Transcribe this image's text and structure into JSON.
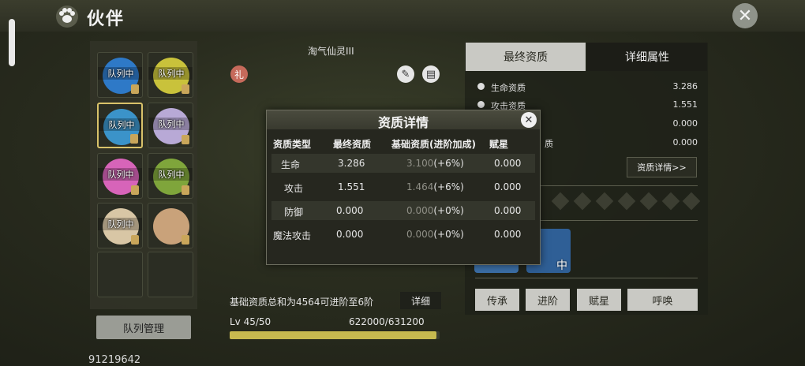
{
  "header": {
    "title": "伙伴",
    "paw_icon": "paw-icon",
    "close_icon": "close-icon"
  },
  "left_panel": {
    "slots": [
      {
        "tag": "队列中",
        "color": "#2e79c7"
      },
      {
        "tag": "队列中",
        "color": "#c9c23b"
      },
      {
        "tag": "队列中",
        "color": "#3b93c9",
        "selected": true
      },
      {
        "tag": "队列中",
        "color": "#b8a9d6"
      },
      {
        "tag": "队列中",
        "color": "#d764b9"
      },
      {
        "tag": "队列中",
        "color": "#7fa53b"
      },
      {
        "tag": "队列中",
        "color": "#d8c6a5"
      },
      {
        "tag": "",
        "color": "#c9a27a"
      },
      {
        "tag": "",
        "color": ""
      },
      {
        "tag": "",
        "color": ""
      }
    ],
    "team_button": "队列管理",
    "uid": "91219642"
  },
  "center": {
    "pet_name": "淘气仙灵III",
    "hint": "基础资质总和为4564可进阶至6阶",
    "detail_button": "详细",
    "level": "Lv 45/50",
    "exp": "622000/631200",
    "exp_progress": 0.985
  },
  "right_panel": {
    "tabs": [
      "最终资质",
      "详细属性"
    ],
    "attributes": [
      {
        "label": "生命资质",
        "value": "3.286"
      },
      {
        "label": "攻击资质",
        "value": "1.551"
      },
      {
        "label": "",
        "value": "0.000"
      },
      {
        "label": "质",
        "value": "0.000"
      }
    ],
    "aptitude_button": "资质详情>>",
    "actions": [
      "传承",
      "进阶",
      "赋星",
      "呼唤"
    ],
    "mini_pet_tag": "中"
  },
  "modal": {
    "title": "资质详情",
    "headers": [
      "资质类型",
      "最终资质",
      "基础资质(进阶加成)",
      "赋星"
    ],
    "rows": [
      {
        "type": "生命",
        "final": "3.286",
        "base": "3.100",
        "bonus": "(+6%)",
        "star": "0.000"
      },
      {
        "type": "攻击",
        "final": "1.551",
        "base": "1.464",
        "bonus": "(+6%)",
        "star": "0.000"
      },
      {
        "type": "防御",
        "final": "0.000",
        "base": "0.000",
        "bonus": "(+0%)",
        "star": "0.000"
      },
      {
        "type": "魔法攻击",
        "final": "0.000",
        "base": "0.000",
        "bonus": "(+0%)",
        "star": "0.000"
      }
    ]
  }
}
